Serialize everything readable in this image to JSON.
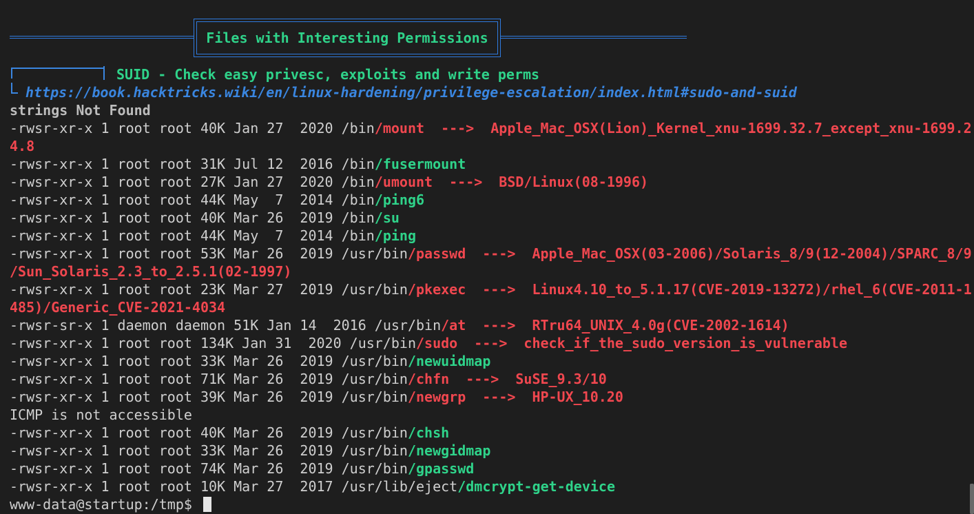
{
  "banner": {
    "title": "Files with Interesting Permissions"
  },
  "section": {
    "title": "SUID - Check easy privesc, exploits and write perms",
    "link": "https://book.hacktricks.wiki/en/linux-hardening/privilege-escalation/index.html#sudo-and-suid"
  },
  "notice": "strings Not Found",
  "lines": [
    {
      "prefix": "-rwsr-xr-x 1 root root 40K Jan 27  2020 /bin",
      "file": "/mount",
      "vuln": true,
      "exploit": "Apple_Mac_OSX(Lion)_Kernel_xnu-1699.32.7_except_xnu-1699.2",
      "wrap": "4.8"
    },
    {
      "prefix": "-rwsr-xr-x 1 root root 31K Jul 12  2016 /bin",
      "file": "/fusermount",
      "vuln": false
    },
    {
      "prefix": "-rwsr-xr-x 1 root root 27K Jan 27  2020 /bin",
      "file": "/umount",
      "vuln": true,
      "exploit": "BSD/Linux(08-1996)"
    },
    {
      "prefix": "-rwsr-xr-x 1 root root 44K May  7  2014 /bin",
      "file": "/ping6",
      "vuln": false
    },
    {
      "prefix": "-rwsr-xr-x 1 root root 40K Mar 26  2019 /bin",
      "file": "/su",
      "vuln": false
    },
    {
      "prefix": "-rwsr-xr-x 1 root root 44K May  7  2014 /bin",
      "file": "/ping",
      "vuln": false
    },
    {
      "prefix": "-rwsr-xr-x 1 root root 53K Mar 26  2019 /usr/bin",
      "file": "/passwd",
      "vuln": true,
      "exploit": "Apple_Mac_OSX(03-2006)/Solaris_8/9(12-2004)/SPARC_8/9",
      "wrap": "/Sun_Solaris_2.3_to_2.5.1(02-1997)"
    },
    {
      "prefix": "-rwsr-xr-x 1 root root 23K Mar 27  2019 /usr/bin",
      "file": "/pkexec",
      "vuln": true,
      "exploit": "Linux4.10_to_5.1.17(CVE-2019-13272)/rhel_6(CVE-2011-1",
      "wrap": "485)/Generic_CVE-2021-4034"
    },
    {
      "prefix": "-rwsr-sr-x 1 daemon daemon 51K Jan 14  2016 /usr/bin",
      "file": "/at",
      "vuln": true,
      "exploit": "RTru64_UNIX_4.0g(CVE-2002-1614)"
    },
    {
      "prefix": "-rwsr-xr-x 1 root root 134K Jan 31  2020 /usr/bin",
      "file": "/sudo",
      "vuln": true,
      "exploit": "check_if_the_sudo_version_is_vulnerable"
    },
    {
      "prefix": "-rwsr-xr-x 1 root root 33K Mar 26  2019 /usr/bin",
      "file": "/newuidmap",
      "vuln": false
    },
    {
      "prefix": "-rwsr-xr-x 1 root root 71K Mar 26  2019 /usr/bin",
      "file": "/chfn",
      "vuln": true,
      "exploit": "SuSE_9.3/10"
    },
    {
      "prefix": "-rwsr-xr-x 1 root root 39K Mar 26  2019 /usr/bin",
      "file": "/newgrp",
      "vuln": true,
      "exploit": "HP-UX_10.20"
    },
    {
      "plain": "ICMP is not accessible"
    },
    {
      "prefix": "-rwsr-xr-x 1 root root 40K Mar 26  2019 /usr/bin",
      "file": "/chsh",
      "vuln": false
    },
    {
      "prefix": "-rwsr-xr-x 1 root root 33K Mar 26  2019 /usr/bin",
      "file": "/newgidmap",
      "vuln": false
    },
    {
      "prefix": "-rwsr-xr-x 1 root root 74K Mar 26  2019 /usr/bin",
      "file": "/gpasswd",
      "vuln": false
    },
    {
      "prefix": "-rwsr-xr-x 1 root root 10K Mar 27  2017 /usr/lib/eject",
      "file": "/dmcrypt-get-device",
      "vuln": false
    }
  ],
  "arrow": "--->",
  "prompt": "www-data@startup:/tmp$ ",
  "colors": {
    "background": "#1e1e1e",
    "text": "#cfcfcf",
    "green": "#2fd38a",
    "red": "#f0474f",
    "blue": "#3a86e0"
  }
}
